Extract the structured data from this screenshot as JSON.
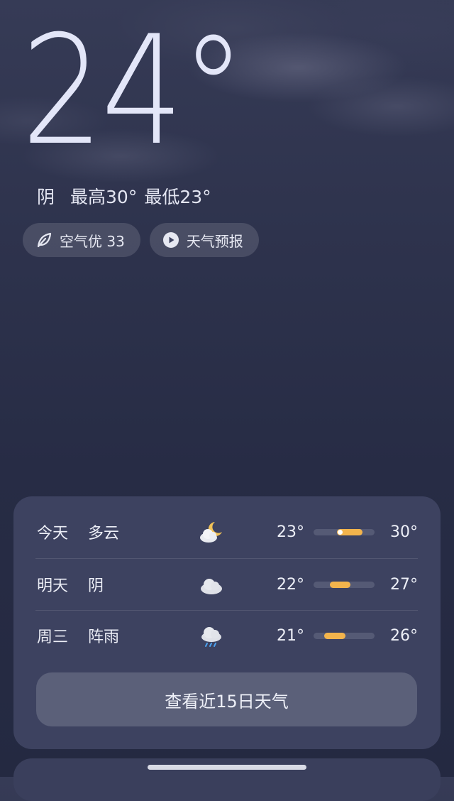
{
  "current": {
    "temperature": "24°",
    "condition": "阴",
    "high": "最高30°",
    "low": "最低23°"
  },
  "chips": {
    "air_quality": "空气优 33",
    "weather_video": "天气预报"
  },
  "forecast": [
    {
      "day": "今天",
      "condition": "多云",
      "icon": "partly-cloudy-night-icon",
      "low": "23°",
      "high": "30°",
      "range_start": 0.38,
      "range_end": 0.8,
      "current_marker": 0.44
    },
    {
      "day": "明天",
      "condition": "阴",
      "icon": "cloudy-icon",
      "low": "22°",
      "high": "27°",
      "range_start": 0.27,
      "range_end": 0.6
    },
    {
      "day": "周三",
      "condition": "阵雨",
      "icon": "rain-shower-icon",
      "low": "21°",
      "high": "26°",
      "range_start": 0.18,
      "range_end": 0.52
    }
  ],
  "more_button": "查看近15日天气",
  "colors": {
    "background_top": "#363b56",
    "background_bottom": "#242941",
    "card": "#3d4260",
    "button": "#5b6079",
    "range_fill": "#f3b44c"
  }
}
